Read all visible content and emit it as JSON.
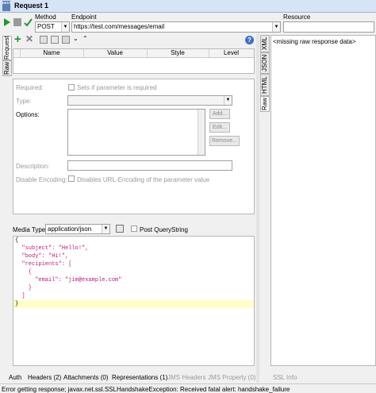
{
  "window": {
    "title": "Request 1",
    "rest_icon_text": "REST"
  },
  "toolbar": {
    "method_label": "Method",
    "endpoint_label": "Endpoint",
    "resource_label": "Resource"
  },
  "request": {
    "method": "POST",
    "endpoint": "https://test.com/messages/email",
    "resource": ""
  },
  "params_toolbar": {
    "help_label": "?"
  },
  "params_table": {
    "columns": [
      "Name",
      "Value",
      "Style",
      "Level"
    ]
  },
  "left_tabs": {
    "request": "Request",
    "raw": "Raw"
  },
  "right_tabs": {
    "xml": "XML",
    "json": "JSON",
    "html": "HTML",
    "raw": "Raw"
  },
  "param_form": {
    "required_label": "Required:",
    "required_hint": "Sets if parameter is required",
    "type_label": "Type:",
    "options_label": "Options:",
    "add_label": "Add...",
    "edit_label": "Edit...",
    "remove_label": "Remove...",
    "description_label": "Description:",
    "disable_encoding_label": "Disable Encoding:",
    "disable_encoding_hint": "Disables URL-Encoding of the parameter value"
  },
  "media": {
    "label": "Media Type",
    "value": "application/json",
    "post_querystring_label": "Post QueryString"
  },
  "body_lines": [
    "{",
    "  \"subject\": \"Hello!\",",
    "  \"body\": \"Hi!\",",
    "  \"recipients\": [",
    "    {",
    "      \"email\": \"jim@example.com\"",
    "    }",
    "  ]",
    "}"
  ],
  "response": {
    "placeholder": "<missing raw response data>"
  },
  "bottom_tabs": [
    "Auth",
    "Headers (2)",
    "Attachments (0)",
    "Representations (1)",
    "JMS Headers",
    "JMS Property (0)"
  ],
  "ssl_info_label": "SSL Info",
  "status": {
    "message": "Error getting response; javax.net.ssl.SSLHandshakeException: Received fatal alert: handshake_failure"
  },
  "colors": {
    "accent": "#5b7fb6",
    "string": "#c2187f",
    "highlight": "#ffffc8"
  }
}
